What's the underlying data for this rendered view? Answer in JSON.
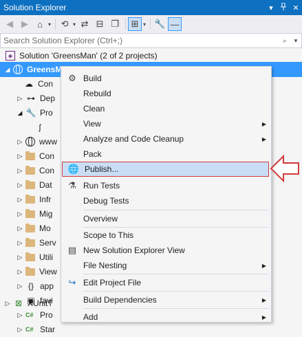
{
  "window": {
    "title": "Solution Explorer",
    "title_buttons": [
      "▾",
      "📌",
      "✕"
    ]
  },
  "toolbar": {
    "buttons": [
      "back-icon",
      "forward-icon",
      "home-icon",
      "sync-icon",
      "history-icon",
      "collapse-icon",
      "copy-icon",
      "show-files-icon",
      "view-icon",
      "properties-icon",
      "preview-icon"
    ]
  },
  "search": {
    "placeholder": "Search Solution Explorer (Ctrl+;)"
  },
  "tree": {
    "solution": "Solution 'GreensMan' (2 of 2 projects)",
    "project": "GreensMan",
    "items": [
      "Con",
      "Dep",
      "Pro",
      "",
      "www",
      "Con",
      "Con",
      "Dat",
      "Infr",
      "Mig",
      "Mo",
      "Serv",
      "Utili",
      "View",
      "app",
      "favi",
      "Pro",
      "Star",
      "XUnitT"
    ]
  },
  "menu": {
    "items": [
      {
        "label": "Build",
        "icon": "build-icon"
      },
      {
        "label": "Rebuild"
      },
      {
        "label": "Clean"
      },
      {
        "label": "View",
        "submenu": true
      },
      {
        "label": "Analyze and Code Cleanup",
        "submenu": true
      },
      {
        "label": "Pack"
      },
      {
        "label": "Publish...",
        "icon": "publish-icon",
        "highlighted": true
      },
      {
        "label": "Run Tests",
        "icon": "run-tests-icon"
      },
      {
        "label": "Debug Tests"
      },
      {
        "label": "Overview"
      },
      {
        "label": "Scope to This"
      },
      {
        "label": "New Solution Explorer View",
        "icon": "new-view-icon"
      },
      {
        "label": "File Nesting",
        "submenu": true
      },
      {
        "label": "Edit Project File",
        "icon": "edit-icon"
      },
      {
        "label": "Build Dependencies",
        "submenu": true
      },
      {
        "label": "Add",
        "submenu": true
      }
    ]
  },
  "colors": {
    "titlebar": "#0e70c0",
    "selection": "#3399ff",
    "highlight_border": "#d23a3a"
  }
}
